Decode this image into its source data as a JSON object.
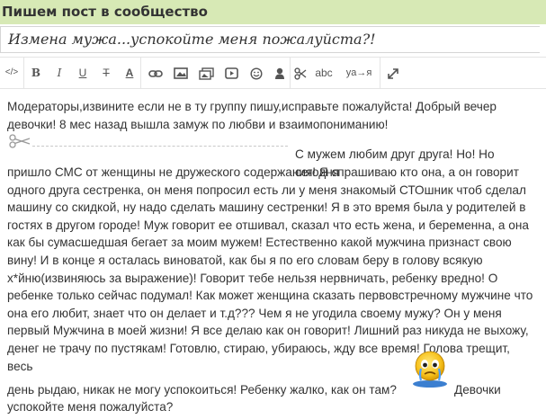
{
  "header": {
    "title": "Пишем пост в сообщество"
  },
  "post": {
    "title_value": "Измена мужа...успокойте меня пожалуйста?!",
    "body": {
      "p1_line1": "Модераторы,извините если не в ту группу пишу,исправьте пожалуйста! Добрый вечер",
      "p1_line2": "девочки! 8 мес назад вышла замуж по любви и взаимопониманию!",
      "cut_label": "",
      "p2_first": "С мужем любим друг друга! Но! Но сегодня",
      "p2_lines": [
        "пришло СМС от женщины не дружеского содержания! Я спрашиваю кто она, а он говорит",
        "одного друга сестренка, он меня попросил есть ли у меня знакомый СТОшник чтоб сделал",
        "машину со скидкой, ну надо сделать машину сестренки! Я в это время была у родителей в",
        "гостях в другом городе! Муж говорит ее отшивал, сказал что есть жена, и беременна, а она",
        "как бы сумасшедшая бегает за моим мужем! Естественно какой мужчина признаст свою",
        "вину! И в конце я осталась виноватой, как бы я по его словам беру в голову всякую",
        "х*йню(извиняюсь за выражение)! Говорит тебе нельзя нервничать, ребенку вредно! О",
        "ребенке только сейчас подумал! Как может женщина сказать первовстречному мужчине что",
        "она его любит, знает что он делает и т.д??? Чем я не угодила своему мужу? Он у меня",
        "первый Мужчина в моей жизни! Я все делаю как он говорит! Лишний раз никуда не выхожу,",
        "денег не трачу по пустякам! Готовлю, стираю, убираюсь, жду все время! Голова трещит, весь"
      ],
      "p3_part1": "день рыдаю, никак не могу успокоиться! Ребенку жалко, как он там?",
      "p3_part2": "Девочки",
      "p3_line2": "успокойте меня пожалуйста?"
    }
  },
  "toolbar": {
    "items": [
      {
        "name": "html-source-button",
        "glyph": "</>"
      },
      {
        "name": "bold-button",
        "glyph": "B"
      },
      {
        "name": "italic-button",
        "glyph": "I"
      },
      {
        "name": "underline-button",
        "glyph": "U"
      },
      {
        "name": "strikethrough-button",
        "glyph": "T"
      },
      {
        "name": "text-color-button",
        "glyph": "A"
      },
      {
        "name": "link-button",
        "glyph": ""
      },
      {
        "name": "image-button",
        "glyph": ""
      },
      {
        "name": "gallery-button",
        "glyph": ""
      },
      {
        "name": "video-button",
        "glyph": ""
      },
      {
        "name": "smiley-button",
        "glyph": ""
      },
      {
        "name": "user-mention-button",
        "glyph": ""
      },
      {
        "name": "cut-button",
        "glyph": ""
      },
      {
        "name": "spellcheck-button",
        "glyph": "abc"
      },
      {
        "name": "transliterate-button",
        "glyph": "ya→я"
      },
      {
        "name": "fullscreen-button",
        "glyph": ""
      }
    ]
  },
  "colors": {
    "header_bg": "#d7e9b5",
    "text": "#333333"
  }
}
